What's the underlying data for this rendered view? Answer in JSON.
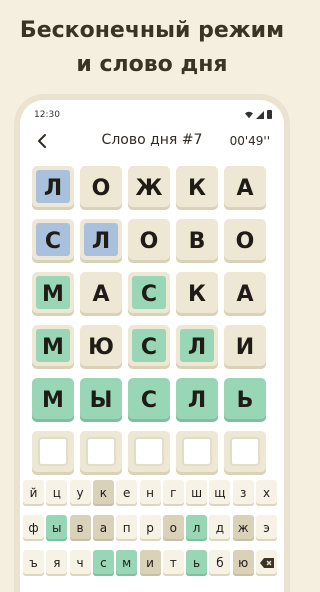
{
  "headline": {
    "line1": "Бесконечный режим",
    "line2": "и слово дня"
  },
  "statusbar": {
    "time": "12:30"
  },
  "appbar": {
    "back_icon": "arrow-back-icon",
    "title": "Слово дня #7",
    "timer": "00'49''"
  },
  "colors": {
    "background": "#f5efe0",
    "tile": "#ede7d3",
    "present_blue": "#a9c1dc",
    "correct_green": "#98d6b6"
  },
  "board": {
    "rows": [
      [
        [
          "Л",
          "blue"
        ],
        [
          "О",
          "none"
        ],
        [
          "Ж",
          "none"
        ],
        [
          "К",
          "none"
        ],
        [
          "А",
          "none"
        ]
      ],
      [
        [
          "С",
          "blue"
        ],
        [
          "Л",
          "blue"
        ],
        [
          "О",
          "none"
        ],
        [
          "В",
          "none"
        ],
        [
          "О",
          "none"
        ]
      ],
      [
        [
          "М",
          "green"
        ],
        [
          "А",
          "none"
        ],
        [
          "С",
          "green"
        ],
        [
          "К",
          "none"
        ],
        [
          "А",
          "none"
        ]
      ],
      [
        [
          "М",
          "green"
        ],
        [
          "Ю",
          "none"
        ],
        [
          "С",
          "green"
        ],
        [
          "Л",
          "green"
        ],
        [
          "И",
          "none"
        ]
      ],
      [
        [
          "М",
          "full"
        ],
        [
          "Ы",
          "full"
        ],
        [
          "С",
          "full"
        ],
        [
          "Л",
          "full"
        ],
        [
          "Ь",
          "full"
        ]
      ],
      [
        [
          "",
          "empty"
        ],
        [
          "",
          "empty"
        ],
        [
          "",
          "empty"
        ],
        [
          "",
          "empty"
        ],
        [
          "",
          "empty"
        ]
      ]
    ]
  },
  "keyboard": {
    "rows": [
      [
        [
          "й",
          "plain"
        ],
        [
          "ц",
          "plain"
        ],
        [
          "у",
          "plain"
        ],
        [
          "к",
          "used"
        ],
        [
          "е",
          "plain"
        ],
        [
          "н",
          "plain"
        ],
        [
          "г",
          "plain"
        ],
        [
          "ш",
          "plain"
        ],
        [
          "щ",
          "plain"
        ],
        [
          "з",
          "plain"
        ],
        [
          "х",
          "plain"
        ]
      ],
      [
        [
          "ф",
          "plain"
        ],
        [
          "ы",
          "green"
        ],
        [
          "в",
          "used"
        ],
        [
          "а",
          "used"
        ],
        [
          "п",
          "plain"
        ],
        [
          "р",
          "plain"
        ],
        [
          "о",
          "used"
        ],
        [
          "л",
          "green"
        ],
        [
          "д",
          "plain"
        ],
        [
          "ж",
          "used"
        ],
        [
          "э",
          "plain"
        ]
      ],
      [
        [
          "ъ",
          "plain"
        ],
        [
          "я",
          "plain"
        ],
        [
          "ч",
          "plain"
        ],
        [
          "с",
          "green"
        ],
        [
          "м",
          "green"
        ],
        [
          "и",
          "used"
        ],
        [
          "т",
          "plain"
        ],
        [
          "ь",
          "green"
        ],
        [
          "б",
          "plain"
        ],
        [
          "ю",
          "used"
        ],
        [
          "delete",
          "del"
        ]
      ]
    ]
  }
}
